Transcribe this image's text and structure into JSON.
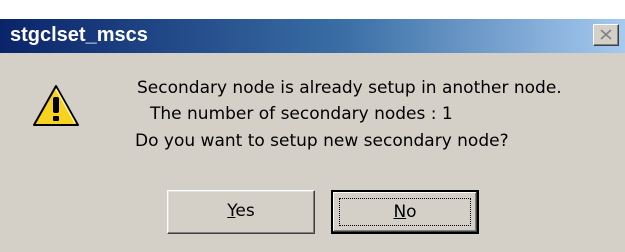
{
  "window": {
    "title": "stgclset_mscs",
    "close_icon": "close-icon"
  },
  "dialog": {
    "icon": "warning-icon",
    "icon_color": "#f7d21e",
    "lines": [
      "Secondary node is already setup in another node.",
      "The number of secondary nodes : 1",
      "Do you want to setup new secondary node?"
    ]
  },
  "buttons": {
    "yes_label": "Yes",
    "no_label": "No",
    "default": "No"
  },
  "colors": {
    "title_gradient_start": "#0a246a",
    "title_gradient_end": "#a6caf0",
    "face": "#d4d0c8"
  }
}
